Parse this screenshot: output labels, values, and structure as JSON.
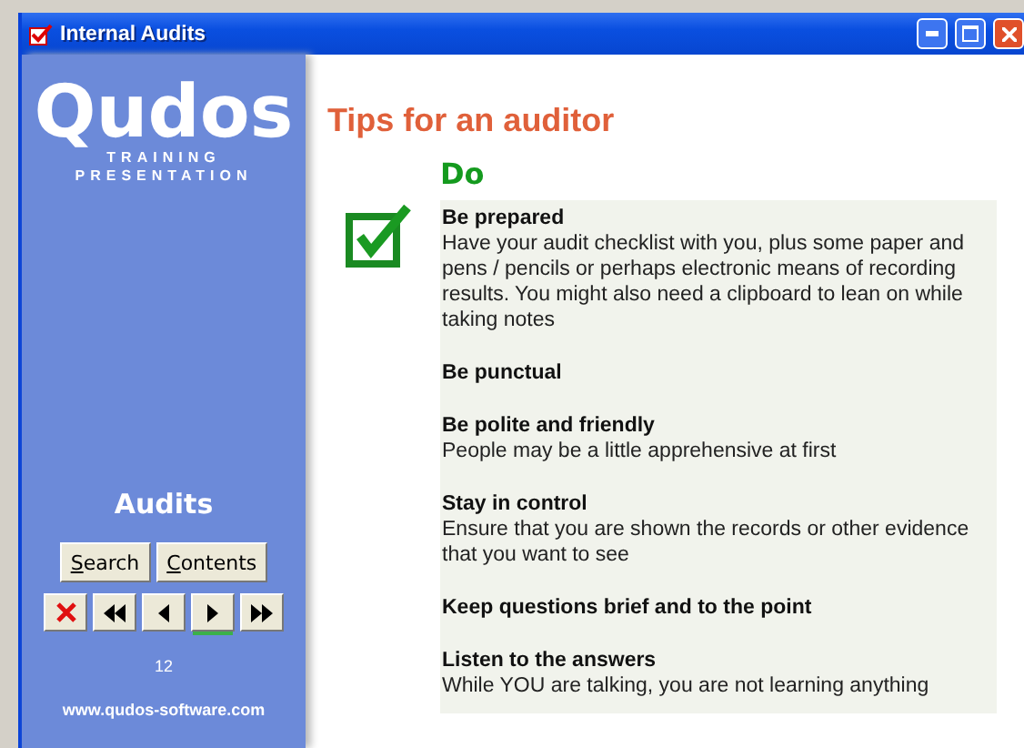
{
  "window": {
    "title": "Internal Audits"
  },
  "sidebar": {
    "logo": "Qudos",
    "logo_sub": [
      "TRAINING",
      "PRESENTATION"
    ],
    "section": "Audits",
    "buttons": [
      {
        "label": "Search"
      },
      {
        "label": "Contents"
      }
    ],
    "nav": [
      {
        "kind": "close",
        "focused": false
      },
      {
        "kind": "first",
        "focused": false
      },
      {
        "kind": "prev",
        "focused": false
      },
      {
        "kind": "next",
        "focused": true
      },
      {
        "kind": "last",
        "focused": false
      }
    ],
    "page": "12",
    "website": "www.qudos-software.com"
  },
  "content": {
    "title": "Tips for an auditor",
    "subtitle": "Do",
    "tips": [
      {
        "heading": "Be prepared",
        "text": "Have your audit checklist with you, plus some paper and pens / pencils or perhaps electronic means of recording results. You might also need a clipboard to lean on while taking notes"
      },
      {
        "heading": "Be punctual"
      },
      {
        "heading": "Be polite and friendly",
        "text": "People may be a little apprehensive at first"
      },
      {
        "heading": "Stay in control",
        "text": "Ensure that you are shown the records or other evidence that you want to see"
      },
      {
        "heading": "Keep questions brief and to the point"
      },
      {
        "heading": "Listen to the answers",
        "text": "While YOU are talking, you are not learning anything"
      }
    ]
  }
}
